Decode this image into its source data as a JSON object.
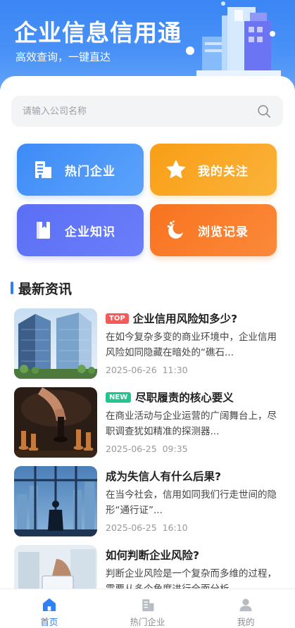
{
  "header": {
    "title": "企业信息信用通",
    "subtitle": "高效查询，一键直达"
  },
  "search": {
    "placeholder": "请输入公司名称",
    "value": ""
  },
  "menu": [
    {
      "label": "热门企业",
      "icon": "building-icon",
      "color": "#3e8bf7"
    },
    {
      "label": "我的关注",
      "icon": "star-icon",
      "color": "#f99e16"
    },
    {
      "label": "企业知识",
      "icon": "book-icon",
      "color": "#5a6ff5"
    },
    {
      "label": "浏览记录",
      "icon": "history-icon",
      "color": "#f8731f"
    }
  ],
  "news": {
    "section_title": "最新资讯",
    "items": [
      {
        "tag": "TOP",
        "title": "企业信用风险知多少?",
        "desc": "在如今复杂多变的商业环境中，企业信用风险如同隐藏在暗处的“礁石...",
        "date": "2025-06-26",
        "time": "11:30"
      },
      {
        "tag": "NEW",
        "title": "尽职履责的核心要义",
        "desc": "在商业活动与企业运营的广阔舞台上，尽职调查犹如精准的探测器...",
        "date": "2025-06-25",
        "time": "09:35"
      },
      {
        "tag": "",
        "title": "成为失信人有什么后果?",
        "desc": "在当今社会，信用如同我们行走世间的隐形“通行证”...",
        "date": "2025-06-25",
        "time": "16:10"
      },
      {
        "tag": "",
        "title": "如何判断企业风险?",
        "desc": "判断企业风险是一个复杂而多维的过程，需要从多个角度进行全面分析",
        "date": "",
        "time": ""
      }
    ]
  },
  "tabbar": [
    {
      "label": "首页",
      "icon": "home-icon",
      "active": true
    },
    {
      "label": "热门企业",
      "icon": "building-icon",
      "active": false
    },
    {
      "label": "我的",
      "icon": "user-icon",
      "active": false
    }
  ],
  "colors": {
    "primary": "#2f80f5",
    "tag_top": "#f45a5a",
    "tag_new": "#22c58d"
  }
}
